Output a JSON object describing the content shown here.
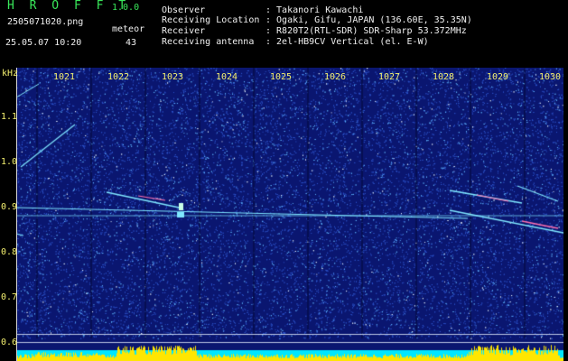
{
  "header": {
    "app_title": "H R O F F T",
    "app_version": "1.0.0",
    "filename": "2505071020.png",
    "timestamp": "25.05.07 10:20",
    "meteor_label": "meteor",
    "meteor_count": "43",
    "fields": [
      {
        "label": "Observer",
        "value": ": Takanori Kawachi"
      },
      {
        "label": "Receiving Location",
        "value": ": Ogaki, Gifu, JAPAN (136.60E, 35.35N)"
      },
      {
        "label": "Receiver",
        "value": ": R820T2(RTL-SDR) SDR-Sharp 53.372MHz"
      },
      {
        "label": "Receiving antenna",
        "value": ": 2el-HB9CV Vertical (el. E-W)"
      }
    ]
  },
  "axis": {
    "y_unit": "kHz",
    "y_ticks": [
      "1.1",
      "1.0",
      "0.9",
      "0.8",
      "0.7",
      "0.6"
    ],
    "x_ticks": [
      "1021",
      "1022",
      "1023",
      "1024",
      "1025",
      "1026",
      "1027",
      "1028",
      "1029",
      "1030"
    ]
  },
  "colors": {
    "app_title": "#39e85a",
    "text": "#f0f0f0",
    "axis": "#f4f070",
    "background": "#0a1670",
    "noise": "#5fb6ff",
    "signal": "#7fe7ff",
    "meteor": "#ff6fb0",
    "bottom_band": "#00e6ff",
    "bottom_bars": "#ffe600"
  }
}
